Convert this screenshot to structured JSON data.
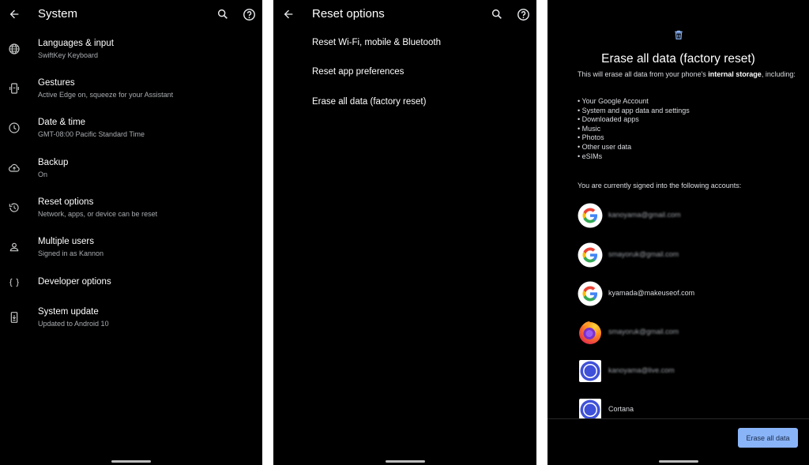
{
  "system": {
    "title": "System",
    "items": [
      {
        "title": "Languages & input",
        "subtitle": "SwiftKey Keyboard",
        "icon": "globe-icon"
      },
      {
        "title": "Gestures",
        "subtitle": "Active Edge on, squeeze for your Assistant",
        "icon": "phone-gesture-icon"
      },
      {
        "title": "Date & time",
        "subtitle": "GMT-08:00 Pacific Standard Time",
        "icon": "clock-icon"
      },
      {
        "title": "Backup",
        "subtitle": "On",
        "icon": "cloud-upload-icon"
      },
      {
        "title": "Reset options",
        "subtitle": "Network, apps, or device can be reset",
        "icon": "history-icon"
      },
      {
        "title": "Multiple users",
        "subtitle": "Signed in as Kannon",
        "icon": "person-icon"
      },
      {
        "title": "Developer options",
        "subtitle": "",
        "icon": "braces-icon"
      },
      {
        "title": "System update",
        "subtitle": "Updated to Android 10",
        "icon": "system-update-icon"
      }
    ]
  },
  "reset": {
    "title": "Reset options",
    "items": [
      "Reset Wi-Fi, mobile & Bluetooth",
      "Reset app preferences",
      "Erase all data (factory reset)"
    ]
  },
  "factory": {
    "title": "Erase all data (factory reset)",
    "desc_pre": "This will erase all data from your phone's ",
    "desc_bold": "internal storage",
    "desc_post": ", including:",
    "list": [
      "• Your Google Account",
      "• System and app data and settings",
      "• Downloaded apps",
      "• Music",
      "• Photos",
      "• Other user data",
      "• eSIMs"
    ],
    "signed_in_text": "You are currently signed into the following accounts:",
    "accounts": [
      {
        "email": "kanoyama@gmail.com",
        "icon": "google-logo-icon",
        "blurred": true
      },
      {
        "email": "smayoruk@gmail.com",
        "icon": "google-logo-icon",
        "blurred": true
      },
      {
        "email": "kyamada@makeuseof.com",
        "icon": "google-logo-icon",
        "blurred": false
      },
      {
        "email": "smayoruk@gmail.com",
        "icon": "firefox-logo-icon",
        "blurred": true
      },
      {
        "email": "kanoyama@live.com",
        "icon": "cortana-logo-icon",
        "blurred": true
      },
      {
        "email": "Cortana",
        "icon": "cortana-logo-icon",
        "blurred": false
      }
    ],
    "button_label": "Erase all data"
  },
  "colors": {
    "background": "#000000",
    "accent_button": "#8ab4f8",
    "google_red": "#ea4335",
    "google_blue": "#4285f4",
    "google_green": "#34a853",
    "google_yellow": "#fbbc05",
    "cortana_blue": "#3f51d8"
  }
}
